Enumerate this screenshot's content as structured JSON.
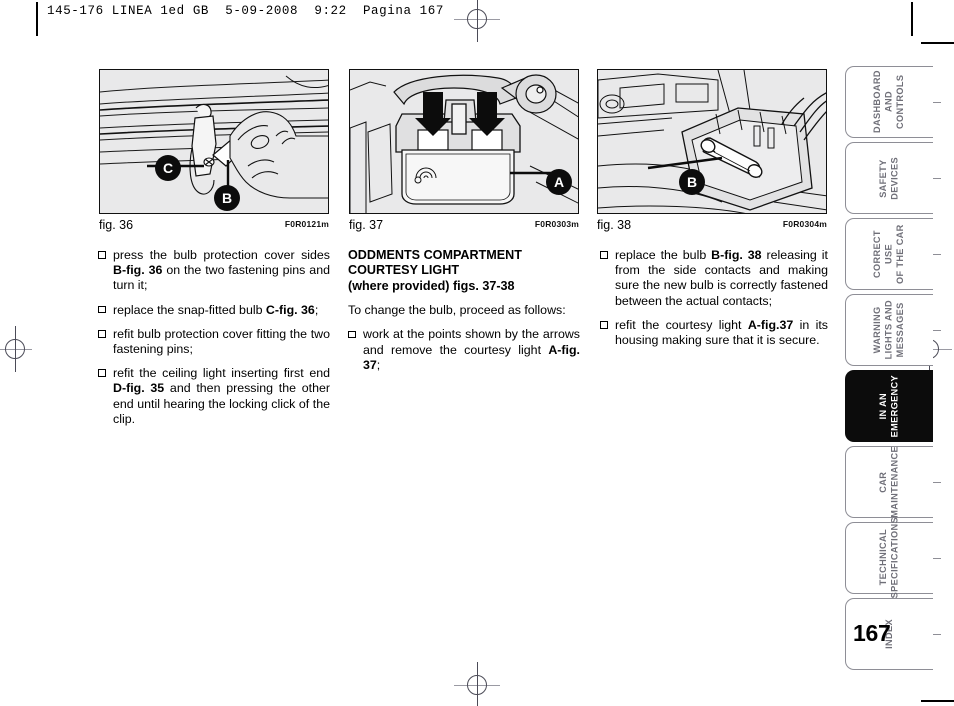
{
  "print_header": {
    "text": "145-176 LINEA 1ed GB  5-09-2008  9:22  Pagina 167"
  },
  "figures": [
    {
      "id": "fig36",
      "caption": "fig. 36",
      "code": "F0R0121m",
      "callouts": [
        "C",
        "B"
      ]
    },
    {
      "id": "fig37",
      "caption": "fig. 37",
      "code": "F0R0303m",
      "callouts": [
        "A"
      ]
    },
    {
      "id": "fig38",
      "caption": "fig. 38",
      "code": "F0R0304m",
      "callouts": [
        "B"
      ]
    }
  ],
  "column1": {
    "bullets": [
      {
        "html": "press the bulb protection cover sides <b>B-fig. 36</b> on the two fastening pins and turn it;"
      },
      {
        "html": "replace the snap-fitted bulb <b>C-fig. 36</b>;"
      },
      {
        "html": "refit bulb protection cover fitting the two fastening pins;"
      },
      {
        "html": "refit the ceiling light inserting first end <b>D-fig. 35</b> and then pressing the other end until hearing the locking click of the clip."
      }
    ]
  },
  "column2": {
    "heading_line1": "ODDMENTS COMPARTMENT",
    "heading_line2": "COURTESY LIGHT",
    "heading_line3": "(where  provided) figs. 37-38",
    "intro": "To change the bulb, proceed as follows:",
    "bullets": [
      {
        "html": "work at the points shown by the arrows and remove the courtesy light <b>A-fig. 37</b>;"
      }
    ]
  },
  "column3": {
    "bullets": [
      {
        "html": "replace the bulb <b>B-fig. 38</b> releasing it from the side contacts and making sure the new bulb is correctly fastened between the actual contacts;"
      },
      {
        "html": "refit the courtesy light <b>A-fig.37</b> in its housing making sure that it is secure."
      }
    ]
  },
  "sidebar": {
    "tabs": [
      {
        "label": "DASHBOARD\nAND CONTROLS",
        "active": false
      },
      {
        "label": "SAFETY\nDEVICES",
        "active": false
      },
      {
        "label": "CORRECT USE\nOF THE CAR",
        "active": false
      },
      {
        "label": "WARNING\nLIGHTS AND\nMESSAGES",
        "active": false
      },
      {
        "label": "IN AN\nEMERGENCY",
        "active": true
      },
      {
        "label": "CAR\nMAINTENANCE",
        "active": false
      },
      {
        "label": "TECHNICAL\nSPECIFICATIONS",
        "active": false
      },
      {
        "label": "INDEX",
        "active": false
      }
    ]
  },
  "page_number": "167"
}
